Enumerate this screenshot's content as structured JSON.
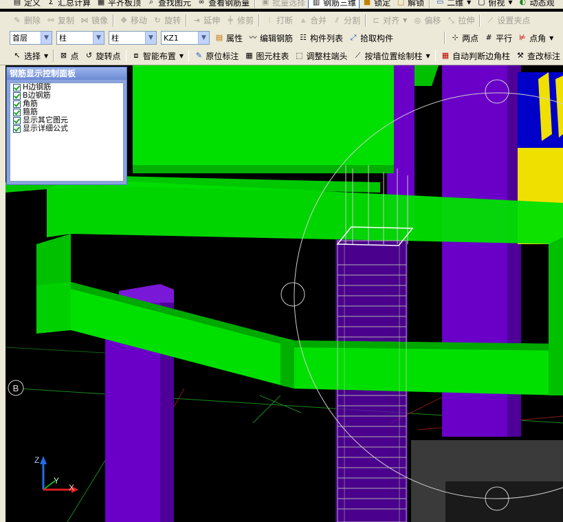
{
  "toolbar_top": {
    "items": [
      "定义",
      "汇总计算",
      "平齐板顶",
      "查找图元",
      "查看钢筋量",
      "批量选择",
      "钢筋三维",
      "锁定",
      "解锁",
      "二维",
      "俯视",
      "动态观"
    ]
  },
  "toolbar_edit": {
    "items": [
      "删除",
      "复制",
      "镜像",
      "移动",
      "旋转",
      "延伸",
      "修剪",
      "打断",
      "合并",
      "分割",
      "对齐",
      "偏移",
      "拉伸",
      "设置夹点"
    ]
  },
  "toolbar_props": {
    "floor": "首层",
    "category": "柱",
    "type": "柱",
    "element": "KZ1",
    "buttons": [
      "属性",
      "编辑钢筋",
      "构件列表",
      "拾取构件"
    ],
    "draw": [
      "两点",
      "平行",
      "点角"
    ]
  },
  "toolbar_draw": {
    "items": [
      "选择",
      "点",
      "旋转点",
      "智能布置",
      "原位标注",
      "图元柱表",
      "调整柱端头",
      "按墙位置绘制柱",
      "自动判断边角柱",
      "查改标注"
    ]
  },
  "panel": {
    "title": "钢筋显示控制面板",
    "options": [
      "H边钢筋",
      "B边钢筋",
      "角筋",
      "箍筋",
      "显示其它图元",
      "显示详细公式"
    ]
  },
  "viewport": {
    "axis_label": "B",
    "axes": {
      "z": "Z",
      "y": "Y",
      "x": "X"
    },
    "colors": {
      "beam": "#00e000",
      "column": "#6a00c8",
      "rebar": "#c8c8c8",
      "background": "#000000"
    }
  }
}
